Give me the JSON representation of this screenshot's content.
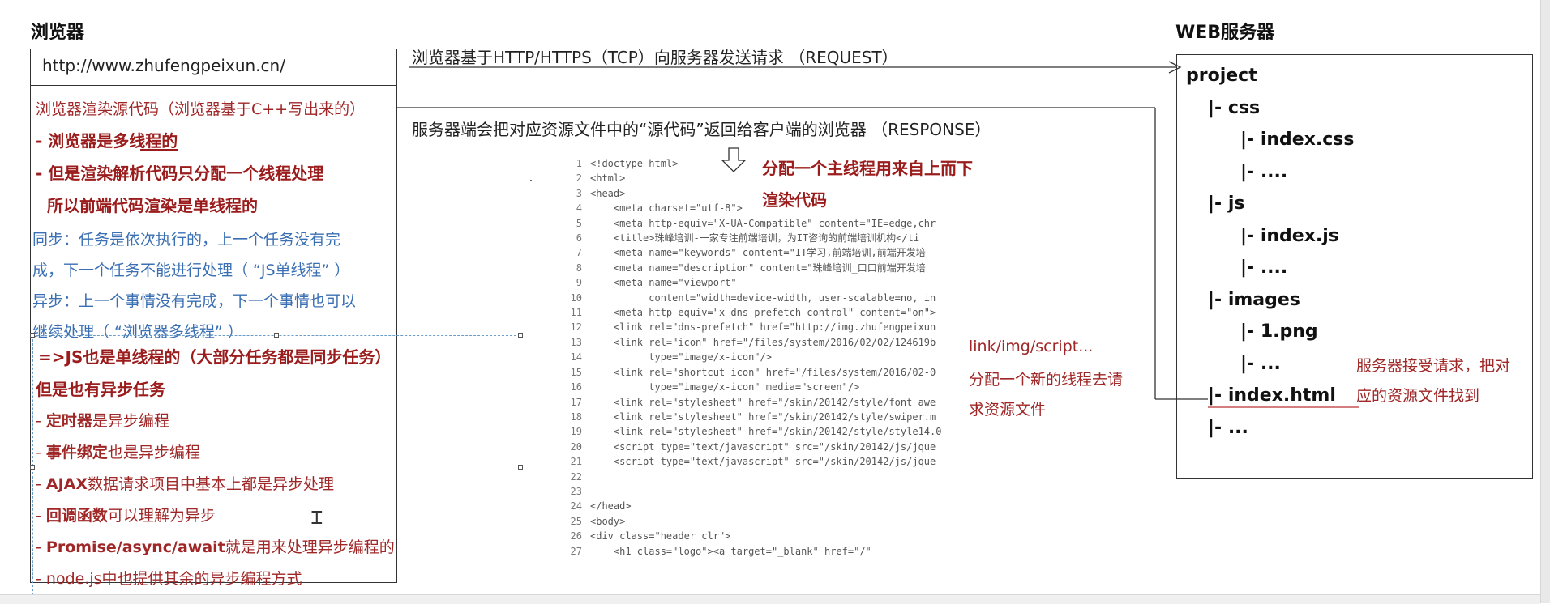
{
  "browser": {
    "title": "浏览器",
    "url": "http://www.zhufengpeixun.cn/",
    "render_note": "浏览器渲染源代码（浏览器基于C++写出来的）",
    "points": [
      "- 浏览器是多线程的",
      "- 但是渲染解析代码只分配一个线程处理",
      "所以前端代码渲染是单线程的"
    ],
    "sync_lines": [
      "同步：任务是依次执行的，上一个任务没有完",
      "成，下一个任务不能进行处理（ “JS单线程” ）",
      "异步：上一个事情没有完成，下一个事情也可以",
      "继续处理（ “浏览器多线程” ）"
    ],
    "js_single": "=>JS也是单线程的（大部分任务都是同步任务）",
    "has_async": "但是也有异步任务",
    "async_items": [
      {
        "bold": "定时器",
        "rest": "是异步编程"
      },
      {
        "bold": "事件绑定",
        "rest": "也是异步编程"
      },
      {
        "bold": "AJAX",
        "rest": "数据请求项目中基本上都是异步处理"
      },
      {
        "bold": "回调函数",
        "rest": "可以理解为异步"
      },
      {
        "bold": "Promise/async/await",
        "rest": "就是用来处理异步编程的"
      },
      {
        "bold": "",
        "rest": "node.js中也提供其余的异步编程方式"
      }
    ]
  },
  "arrows": {
    "request": "浏览器基于HTTP/HTTPS（TCP）向服务器发送请求 （REQUEST）",
    "response": "服务器端会把对应资源文件中的“源代码”返回给客户端的浏览器 （RESPONSE）"
  },
  "main_thread": [
    "分配一个主线程用来自上而下",
    "渲染代码"
  ],
  "resource_note": [
    "link/img/script...",
    "分配一个新的线程去请",
    "求资源文件"
  ],
  "server": {
    "title": "WEB服务器",
    "tree": [
      {
        "label": "project",
        "depth": 0
      },
      {
        "label": "|- css",
        "depth": 1
      },
      {
        "label": "|- index.css",
        "depth": 2
      },
      {
        "label": "|- ....",
        "depth": 2
      },
      {
        "label": "|- js",
        "depth": 1
      },
      {
        "label": "|- index.js",
        "depth": 2
      },
      {
        "label": "|- ....",
        "depth": 2
      },
      {
        "label": "|- images",
        "depth": 1
      },
      {
        "label": "|- 1.png",
        "depth": 2
      },
      {
        "label": "|- ...",
        "depth": 2
      },
      {
        "label": "|- index.html",
        "depth": 1
      },
      {
        "label": "|- ...",
        "depth": 1
      }
    ],
    "note": [
      "服务器接受请求，把对",
      "应的资源文件找到"
    ]
  },
  "code_lines": [
    "<!doctype html>",
    "<html>",
    "<head>",
    "    <meta charset=\"utf-8\">",
    "    <meta http-equiv=\"X-UA-Compatible\" content=\"IE=edge,chr",
    "    <title>珠峰培训-一家专注前端培训，为IT咨询的前端培训机构</ti",
    "    <meta name=\"keywords\" content=\"IT学习,前端培训,前端开发培",
    "    <meta name=\"description\" content=\"珠峰培训_口口前端开发培",
    "    <meta name=\"viewport\"",
    "          content=\"width=device-width, user-scalable=no, in",
    "    <meta http-equiv=\"x-dns-prefetch-control\" content=\"on\">",
    "    <link rel=\"dns-prefetch\" href=\"http://img.zhufengpeixun",
    "    <link rel=\"icon\" href=\"/files/system/2016/02/02/124619b",
    "          type=\"image/x-icon\"/>",
    "    <link rel=\"shortcut icon\" href=\"/files/system/2016/02-0",
    "          type=\"image/x-icon\" media=\"screen\"/>",
    "    <link rel=\"stylesheet\" href=\"/skin/20142/style/font awe",
    "    <link rel=\"stylesheet\" href=\"/skin/20142/style/swiper.m",
    "    <link rel=\"stylesheet\" href=\"/skin/20142/style/style14.0",
    "    <script type=\"text/javascript\" src=\"/skin/20142/js/jque",
    "    <script type=\"text/javascript\" src=\"/skin/20142/js/jque",
    "",
    "",
    "</head>",
    "<body>",
    "<div class=\"header clr\">",
    "    <h1 class=\"logo\"><a target=\"_blank\" href=\"/\""
  ]
}
